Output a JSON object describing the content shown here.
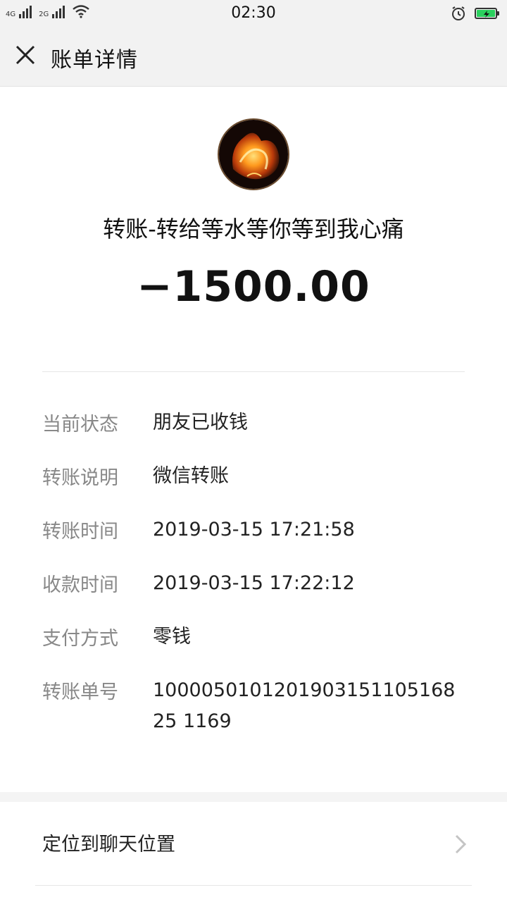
{
  "status_bar": {
    "network_1": "4G",
    "network_2": "2G",
    "time": "02:30",
    "icons": [
      "signal-bars-icon",
      "wifi-icon",
      "alarm-icon",
      "battery-charging-icon"
    ],
    "battery_color": "#2bd05e"
  },
  "nav": {
    "title": "账单详情",
    "close_icon": "close-icon"
  },
  "transfer": {
    "title": "转账-转给等水等你等到我心痛",
    "amount": "−1500.00"
  },
  "details": [
    {
      "label": "当前状态",
      "value": "朋友已收钱"
    },
    {
      "label": "转账说明",
      "value": "微信转账"
    },
    {
      "label": "转账时间",
      "value": "2019-03-15 17:21:58"
    },
    {
      "label": "收款时间",
      "value": "2019-03-15 17:22:12"
    },
    {
      "label": "支付方式",
      "value": "零钱"
    },
    {
      "label": "转账单号",
      "value": "100005010120190315110516825 1169"
    }
  ],
  "actions": {
    "locate_chat": "定位到聊天位置",
    "chevron_icon": "chevron-right-icon"
  },
  "colors": {
    "bar_bg": "#f2f2f2",
    "label_gray": "#888888",
    "text_dark": "#222222"
  }
}
